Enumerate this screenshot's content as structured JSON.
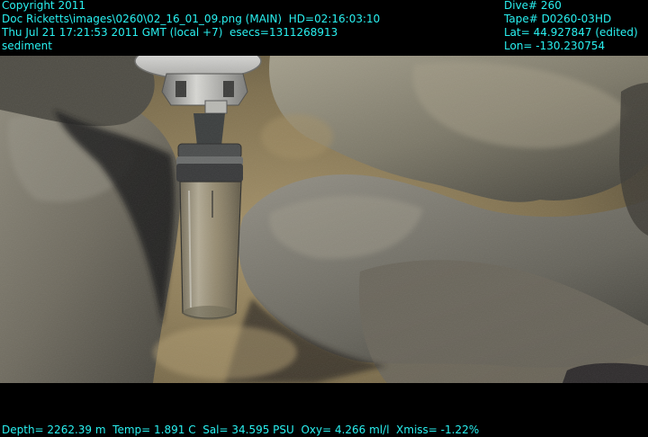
{
  "overlay": {
    "left_lines": [
      "Copyright 2011",
      "Doc Ricketts\\images\\0260\\02_16_01_09.png (MAIN)  HD=02:16:03:10",
      "Thu Jul 21 17:21:53 2011 GMT (local +7)  esecs=1311268913",
      "sediment"
    ],
    "right_lines": [
      "Dive# 260",
      "Tape# D0260-03HD",
      "Lat= 44.927847 (edited)",
      "Lon= -130.230754"
    ],
    "bottom_line": "Depth= 2262.39 m  Temp= 1.891 C  Sal= 34.595 PSU  Oxy= 4.266 ml/l  Xmiss= -1.22%"
  },
  "colors": {
    "overlay_text": "#29f0f0",
    "background": "#000000"
  }
}
